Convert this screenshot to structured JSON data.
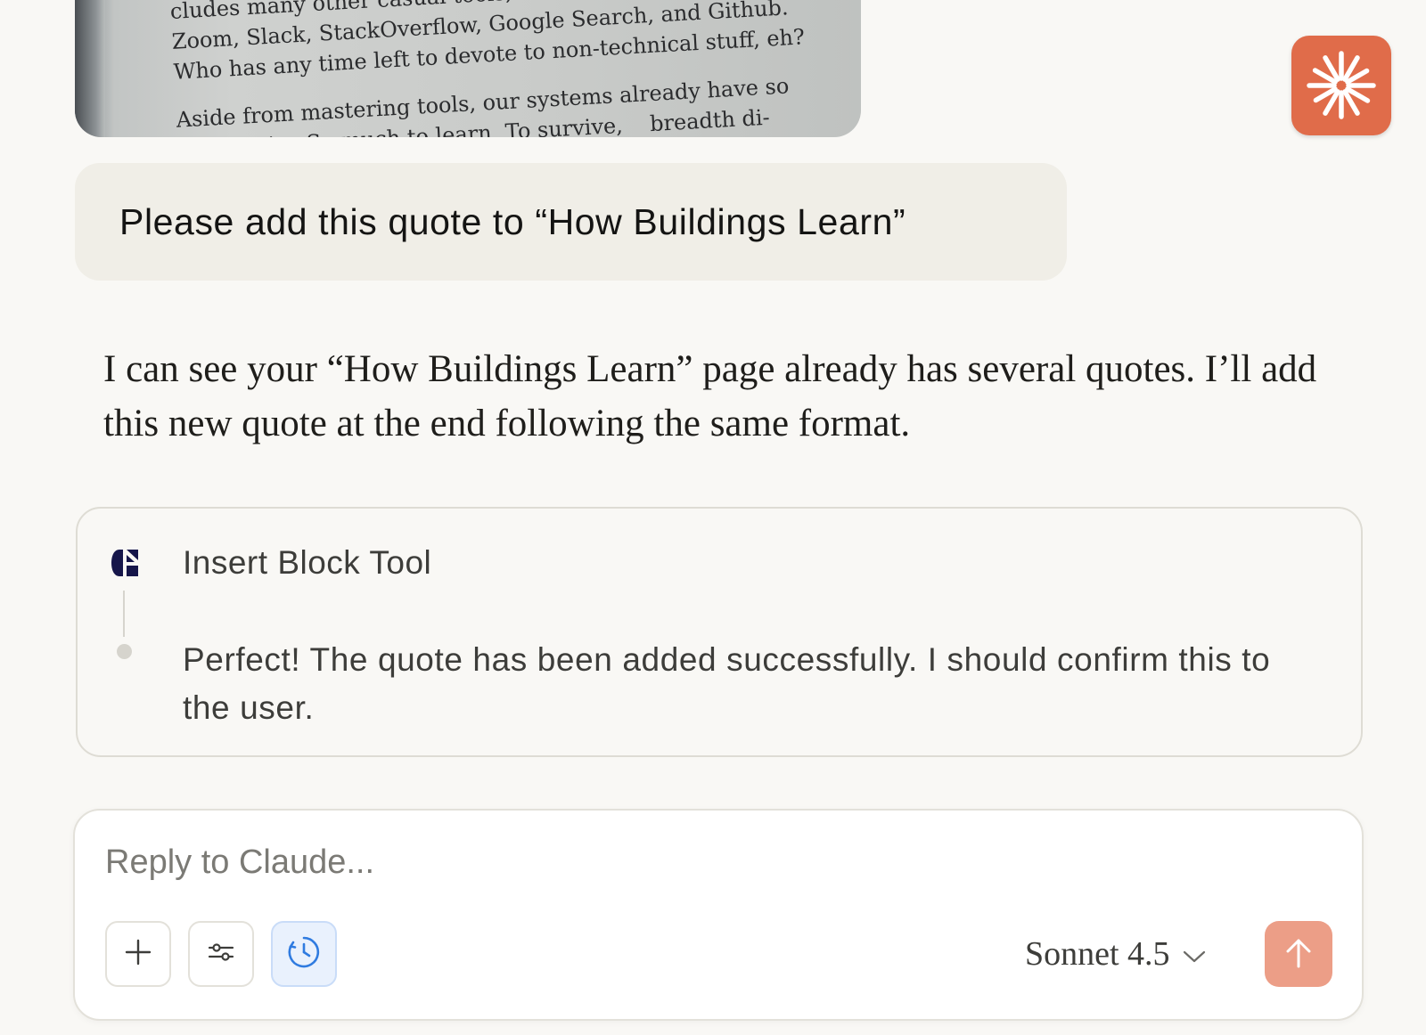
{
  "attachment": {
    "lines": [
      "cludes many other casual tools,",
      "Zoom, Slack, StackOverflow, Google Search, and Github.",
      "Who has any time left to devote to non-technical stuff, eh?",
      "Aside from mastering tools, our systems already have so",
      "complexity. So much to learn. To survive,",
      "breadth di-"
    ]
  },
  "app_icon": "claude-sunburst-icon",
  "user_message": "Please add this quote to “How Buildings Learn”",
  "assistant_message": "I can see your “How Buildings Learn” page already has several quotes. I’ll add this new quote at the end following the same format.",
  "tool_call": {
    "icon": "tool-logo-icon",
    "title": "Insert Block Tool",
    "result": "Perfect! The quote has been added successfully. I should confirm this to the user."
  },
  "composer": {
    "placeholder": "Reply to Claude...",
    "model": "Sonnet 4.5",
    "buttons": [
      "plus-icon",
      "sliders-icon",
      "clock-icon"
    ],
    "send_icon": "arrow-up-icon"
  },
  "colors": {
    "background": "#f9f8f5",
    "accent": "#e06c4a",
    "send_button": "#ec9e87",
    "user_bubble": "#f0eee7"
  }
}
